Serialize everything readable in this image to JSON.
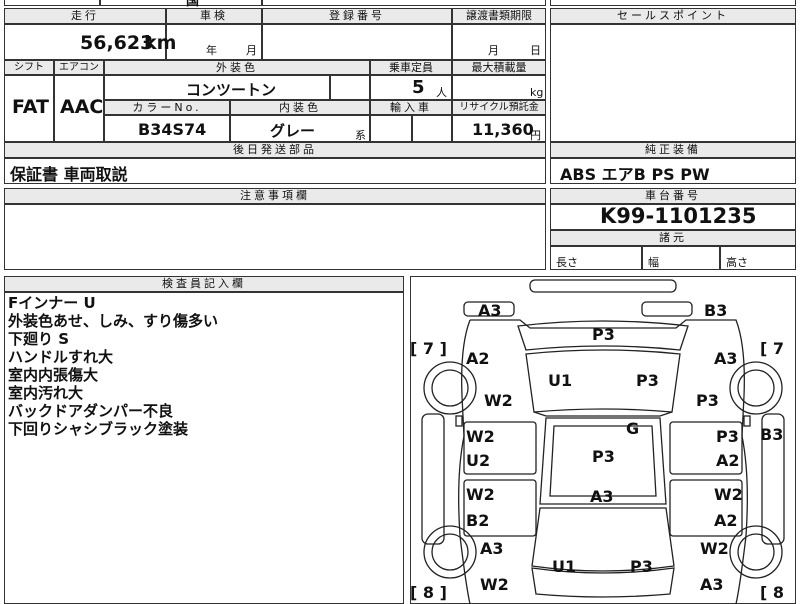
{
  "top_partial": "国",
  "mileage": {
    "header": "走行",
    "value": "56,623",
    "unit": "km"
  },
  "inspection": {
    "header": "車検",
    "year_unit": "年",
    "month_unit": "月"
  },
  "registration": {
    "header": "登録番号",
    "value": ""
  },
  "transfer": {
    "header": "譲渡書類期限",
    "month_unit": "月",
    "day_unit": "日"
  },
  "sales_point": {
    "header": "セールスポイント",
    "value": ""
  },
  "shift": {
    "header": "シフト",
    "value": "FAT"
  },
  "aircon": {
    "header": "エアコン",
    "value": "AAC"
  },
  "exterior_color": {
    "header": "外装色",
    "value": "コンツートン"
  },
  "capacity": {
    "header": "乗車定員",
    "value": "5",
    "unit": "人"
  },
  "max_load": {
    "header": "最大積載量",
    "unit": "kg"
  },
  "color_no": {
    "header": "カラーNo.",
    "value": "B34S74"
  },
  "interior_color": {
    "header": "内装色",
    "value": "グレー",
    "suffix": "系"
  },
  "import_car": {
    "header": "輸入車"
  },
  "recycle": {
    "header": "リサイクル預託金",
    "value": "11,360",
    "unit": "円"
  },
  "later_parts": {
    "header": "後日発送部品",
    "value": "保証書 車両取説"
  },
  "equipment": {
    "header": "純正装備",
    "value": "ABS エアB PS PW"
  },
  "caution": {
    "header": "注意事項欄"
  },
  "chassis": {
    "header": "車台番号",
    "value": "K99-1101235"
  },
  "dimensions": {
    "header": "諸元",
    "length": "長さ",
    "width": "幅",
    "height": "高さ"
  },
  "inspector": {
    "header": "検査員記入欄",
    "notes": [
      "Fインナー U",
      "外装色あせ、しみ、すり傷多い",
      "下廻り S",
      "ハンドルすれ大",
      "室内内張傷大",
      "室内汚れ大",
      "バックドアダンパー不良",
      "下回りシャシブラック塗装"
    ]
  },
  "diagram": {
    "left_seven": "[ 7 ]",
    "right_seven": "[ 7",
    "left_eight": "[ 8 ]",
    "right_eight": "[ 8",
    "marks": {
      "front_left": "A3",
      "front_right": "B3",
      "bonnet": "P3",
      "fender_fl": "A2",
      "fender_fr": "A3",
      "windshield": "U1",
      "roof_front": "P3",
      "wheel_fl": "W2",
      "wheel_fr": "P3",
      "roof": "G",
      "roof_center": "P3",
      "door_fl_1": "W2",
      "door_fl_2": "U2",
      "door_fr_1": "P3",
      "door_fr_2": "A2",
      "side_right": "B3",
      "lower_center": "A3",
      "door_rl_1": "W2",
      "door_rl_2": "B2",
      "door_rr_1": "W2",
      "door_rr_2": "A2",
      "quarter_rl": "A3",
      "wheel_rr": "W2",
      "rear_window": "U1",
      "rear_center": "P3",
      "bumper_rl": "W2",
      "bumper_rr": "A3"
    }
  }
}
